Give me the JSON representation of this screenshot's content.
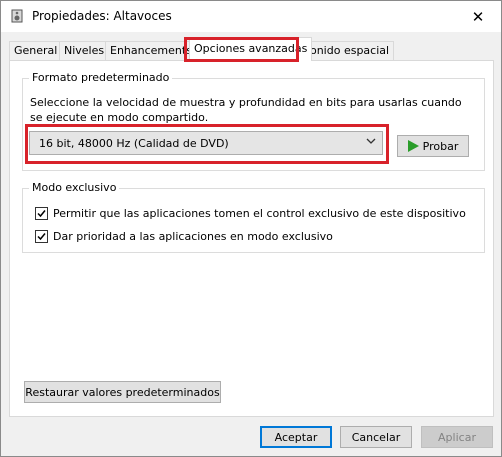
{
  "window": {
    "title": "Propiedades: Altavoces",
    "close_glyph": "✕"
  },
  "tabs": [
    {
      "label": "General"
    },
    {
      "label": "Niveles"
    },
    {
      "label": "Enhancements"
    },
    {
      "label": "Opciones avanzadas",
      "active": true
    },
    {
      "label": "Sonido espacial"
    }
  ],
  "default_format": {
    "legend": "Formato predeterminado",
    "description": "Seleccione la velocidad de muestra y profundidad en bits para usarlas cuando se ejecute en modo compartido.",
    "selected_value": "16 bit, 48000 Hz (Calidad de DVD)",
    "test_button": "Probar"
  },
  "exclusive_mode": {
    "legend": "Modo exclusivo",
    "options": [
      {
        "label": "Permitir que las aplicaciones tomen el control exclusivo de este dispositivo",
        "checked": true
      },
      {
        "label": "Dar prioridad a las aplicaciones en modo exclusivo",
        "checked": true
      }
    ]
  },
  "restore_button": "Restaurar valores predeterminados",
  "footer": {
    "accept": "Aceptar",
    "cancel": "Cancelar",
    "apply": "Aplicar"
  },
  "colors": {
    "highlight": "#d8222a",
    "accent": "#0078d7",
    "play_icon": "#2a9d2a"
  },
  "icons": {
    "title": "speaker-icon",
    "dropdown": "chevron-down-icon",
    "play": "play-icon",
    "check": "checkmark-icon"
  }
}
